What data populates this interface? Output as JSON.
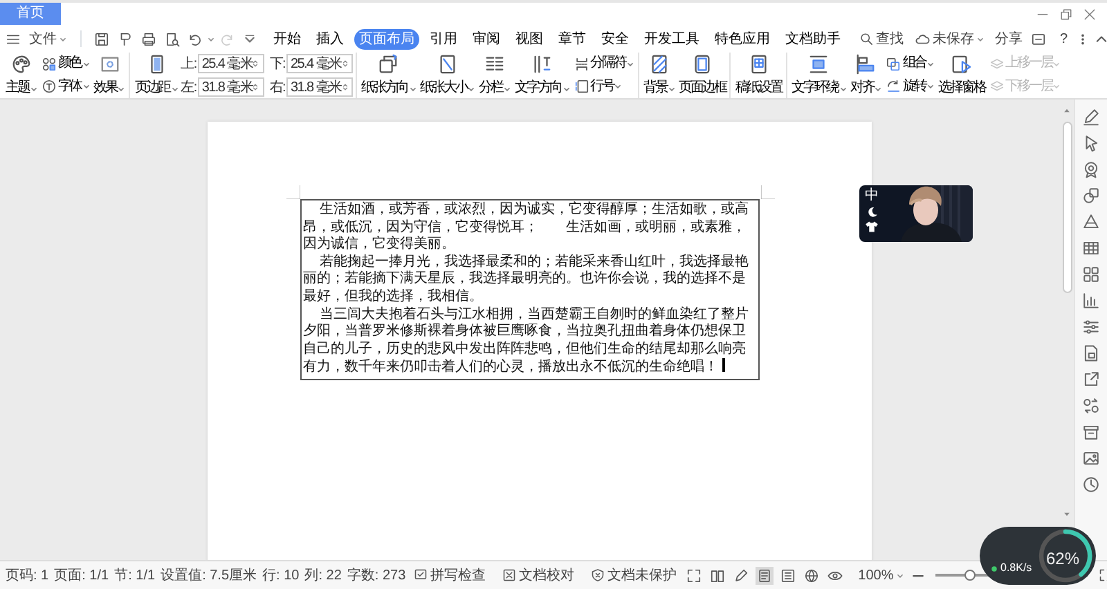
{
  "tabs": [
    {
      "label": "首页",
      "selected": true
    }
  ],
  "file_menu": "文件",
  "ribbon_tabs": [
    {
      "label": "开始",
      "selected": false
    },
    {
      "label": "插入",
      "selected": false
    },
    {
      "label": "页面布局",
      "selected": true
    },
    {
      "label": "引用",
      "selected": false
    },
    {
      "label": "审阅",
      "selected": false
    },
    {
      "label": "视图",
      "selected": false
    },
    {
      "label": "章节",
      "selected": false
    },
    {
      "label": "安全",
      "selected": false
    },
    {
      "label": "开发工具",
      "selected": false
    },
    {
      "label": "特色应用",
      "selected": false
    },
    {
      "label": "文档助手",
      "selected": false
    }
  ],
  "search": "查找",
  "save_status": "未保存",
  "share": "分享",
  "help": "?",
  "ribbon": [
    [
      {
        "kind": "big",
        "label": "主题",
        "dropdown": true
      },
      {
        "kind": "stack",
        "items": [
          {
            "label": "颜色",
            "dropdown": true,
            "disabled": false
          },
          {
            "label": "字体",
            "dropdown": true,
            "disabled": false
          }
        ]
      },
      {
        "kind": "big",
        "label": "效果",
        "dropdown": true
      }
    ],
    [
      {
        "kind": "big",
        "label": "页边距",
        "dropdown": true
      },
      {
        "kind": "fields",
        "items": [
          {
            "label": "上:",
            "value": "25.4 毫米"
          },
          {
            "label": "下:",
            "value": "25.4 毫米"
          },
          {
            "label": "左:",
            "value": "31.8 毫米"
          },
          {
            "label": "右:",
            "value": "31.8 毫米"
          }
        ]
      }
    ],
    [
      {
        "kind": "big",
        "label": "纸张方向",
        "dropdown": true
      },
      {
        "kind": "big",
        "label": "纸张大小",
        "dropdown": true
      },
      {
        "kind": "big",
        "label": "分栏",
        "dropdown": true
      },
      {
        "kind": "big",
        "label": "文字方向",
        "dropdown": true
      },
      {
        "kind": "stack",
        "items": [
          {
            "label": "分隔符",
            "dropdown": true,
            "disabled": false
          },
          {
            "label": "行号",
            "dropdown": true,
            "disabled": false
          }
        ]
      }
    ],
    [
      {
        "kind": "big",
        "label": "背景",
        "dropdown": true
      },
      {
        "kind": "big",
        "label": "页面边框",
        "dropdown": false
      }
    ],
    [
      {
        "kind": "big",
        "label": "稿纸设置",
        "dropdown": false
      }
    ],
    [
      {
        "kind": "big",
        "label": "文字环绕",
        "dropdown": true
      },
      {
        "kind": "big",
        "label": "对齐",
        "dropdown": true
      },
      {
        "kind": "stack",
        "items": [
          {
            "label": "组合",
            "dropdown": true,
            "disabled": false
          },
          {
            "label": "旋转",
            "dropdown": true,
            "disabled": false
          }
        ]
      },
      {
        "kind": "big",
        "label": "选择窗格",
        "dropdown": false
      },
      {
        "kind": "stack",
        "items": [
          {
            "label": "上移一层",
            "dropdown": true,
            "disabled": true
          },
          {
            "label": "下移一层",
            "dropdown": true,
            "disabled": true
          }
        ]
      }
    ]
  ],
  "document": {
    "paragraphs": [
      "生活如酒，或芳香，或浓烈，因为诚实，它变得醇厚；生活如歌，或高昂，或低沉，因为守信，它变得悦耳；　　生活如画，或明丽，或素雅，因为诚信，它变得美丽。",
      "若能掬起一捧月光，我选择最柔和的；若能采来香山红叶，我选择最艳丽的；若能摘下满天星辰，我选择最明亮的。也许你会说，我的选择不是最好，但我的选择，我相信。",
      "当三闾大夫抱着石头与江水相拥，当西楚霸王自刎时的鲜血染红了整片夕阳，当普罗米修斯裸着身体被巨鹰啄食，当拉奥孔扭曲着身体仍想保卫自己的儿子，历史的悲风中发出阵阵悲鸣，但他们生命的结尾却那么响亮有力，数千年来仍叩击着人们的心灵，播放出永不低沉的生命绝唱！"
    ]
  },
  "ime": {
    "mode": "中"
  },
  "status_bar": {
    "items": [
      "页码: 1",
      "页面: 1/1",
      "节: 1/1",
      "设置值: 7.5厘米",
      "行: 10",
      "列: 22",
      "字数: 273"
    ],
    "buttons": [
      "拼写检查",
      "文档校对",
      "文档未保护"
    ],
    "view_modes": [
      {
        "selected": false
      },
      {
        "selected": false
      },
      {
        "selected": false
      },
      {
        "selected": true
      },
      {
        "selected": false
      },
      {
        "selected": false
      },
      {
        "selected": false
      }
    ],
    "zoom": "100%",
    "zoom_slider": {
      "level": 0.5
    }
  },
  "speed_widget": {
    "percent": "62%",
    "rate": "0.8K/s"
  }
}
